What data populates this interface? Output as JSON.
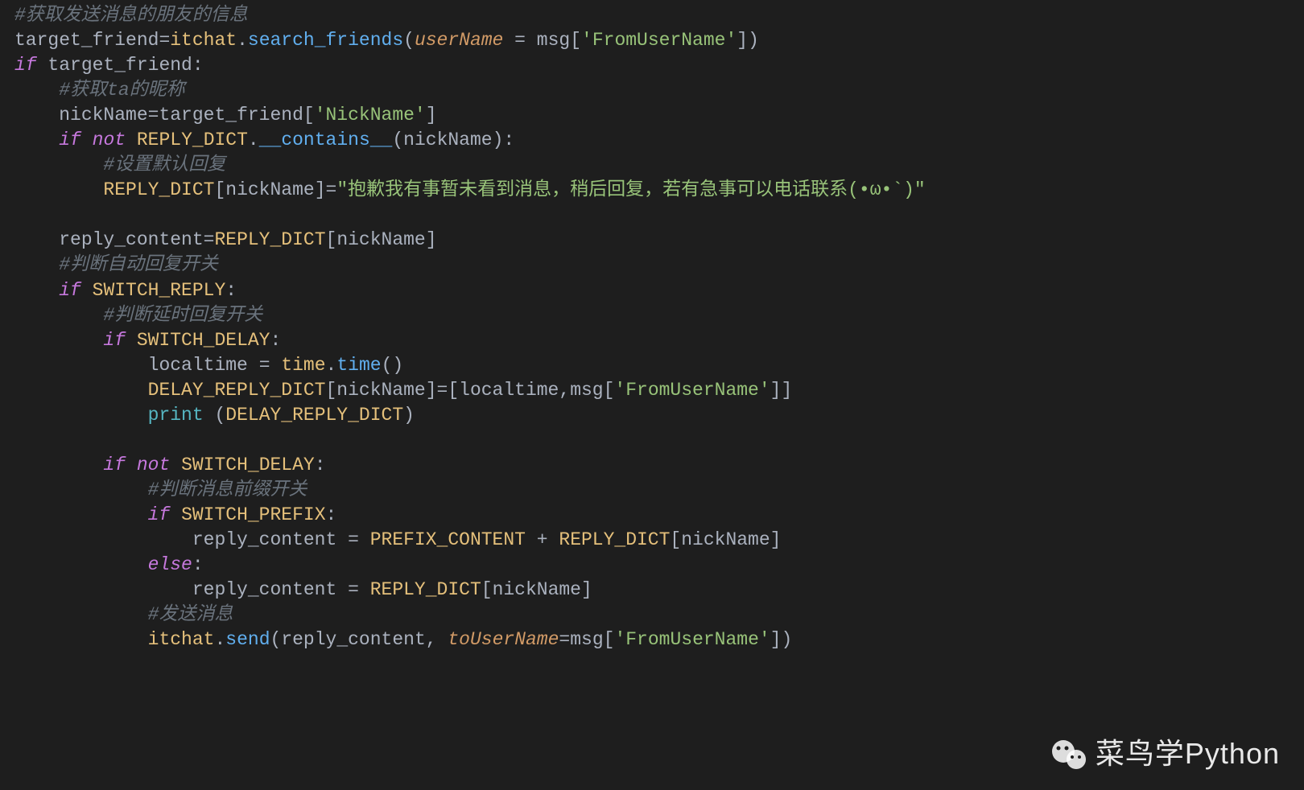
{
  "code": {
    "l1": "#获取发送消息的朋友的信息",
    "l2a": "target_friend",
    "l2b": "itchat",
    "l2c": "search_friends",
    "l2d": "userName",
    "l2e": "msg",
    "l2f": "'FromUserName'",
    "l3a": "if",
    "l3b": "target_friend",
    "l4": "#获取ta的昵称",
    "l5a": "nickName",
    "l5b": "target_friend",
    "l5c": "'NickName'",
    "l6a": "if",
    "l6b": "not",
    "l6c": "REPLY_DICT",
    "l6d": "__contains__",
    "l6e": "nickName",
    "l7": "#设置默认回复",
    "l8a": "REPLY_DICT",
    "l8b": "nickName",
    "l8c": "\"抱歉我有事暂未看到消息，稍后回复，若有急事可以电话联系(•ω•`)\"",
    "l10a": "reply_content",
    "l10b": "REPLY_DICT",
    "l10c": "nickName",
    "l11": "#判断自动回复开关",
    "l12a": "if",
    "l12b": "SWITCH_REPLY",
    "l13": "#判断延时回复开关",
    "l14a": "if",
    "l14b": "SWITCH_DELAY",
    "l15a": "localtime",
    "l15b": "time",
    "l15c": "time",
    "l16a": "DELAY_REPLY_DICT",
    "l16b": "nickName",
    "l16c": "localtime",
    "l16d": "msg",
    "l16e": "'FromUserName'",
    "l17a": "print",
    "l17b": "DELAY_REPLY_DICT",
    "l19a": "if",
    "l19b": "not",
    "l19c": "SWITCH_DELAY",
    "l20": "#判断消息前缀开关",
    "l21a": "if",
    "l21b": "SWITCH_PREFIX",
    "l22a": "reply_content",
    "l22b": "PREFIX_CONTENT",
    "l22c": "REPLY_DICT",
    "l22d": "nickName",
    "l23a": "else",
    "l24a": "reply_content",
    "l24b": "REPLY_DICT",
    "l24c": "nickName",
    "l25": "#发送消息",
    "l26a": "itchat",
    "l26b": "send",
    "l26c": "reply_content",
    "l26d": "toUserName",
    "l26e": "msg",
    "l26f": "'FromUserName'"
  },
  "watermark": "菜鸟学Python"
}
